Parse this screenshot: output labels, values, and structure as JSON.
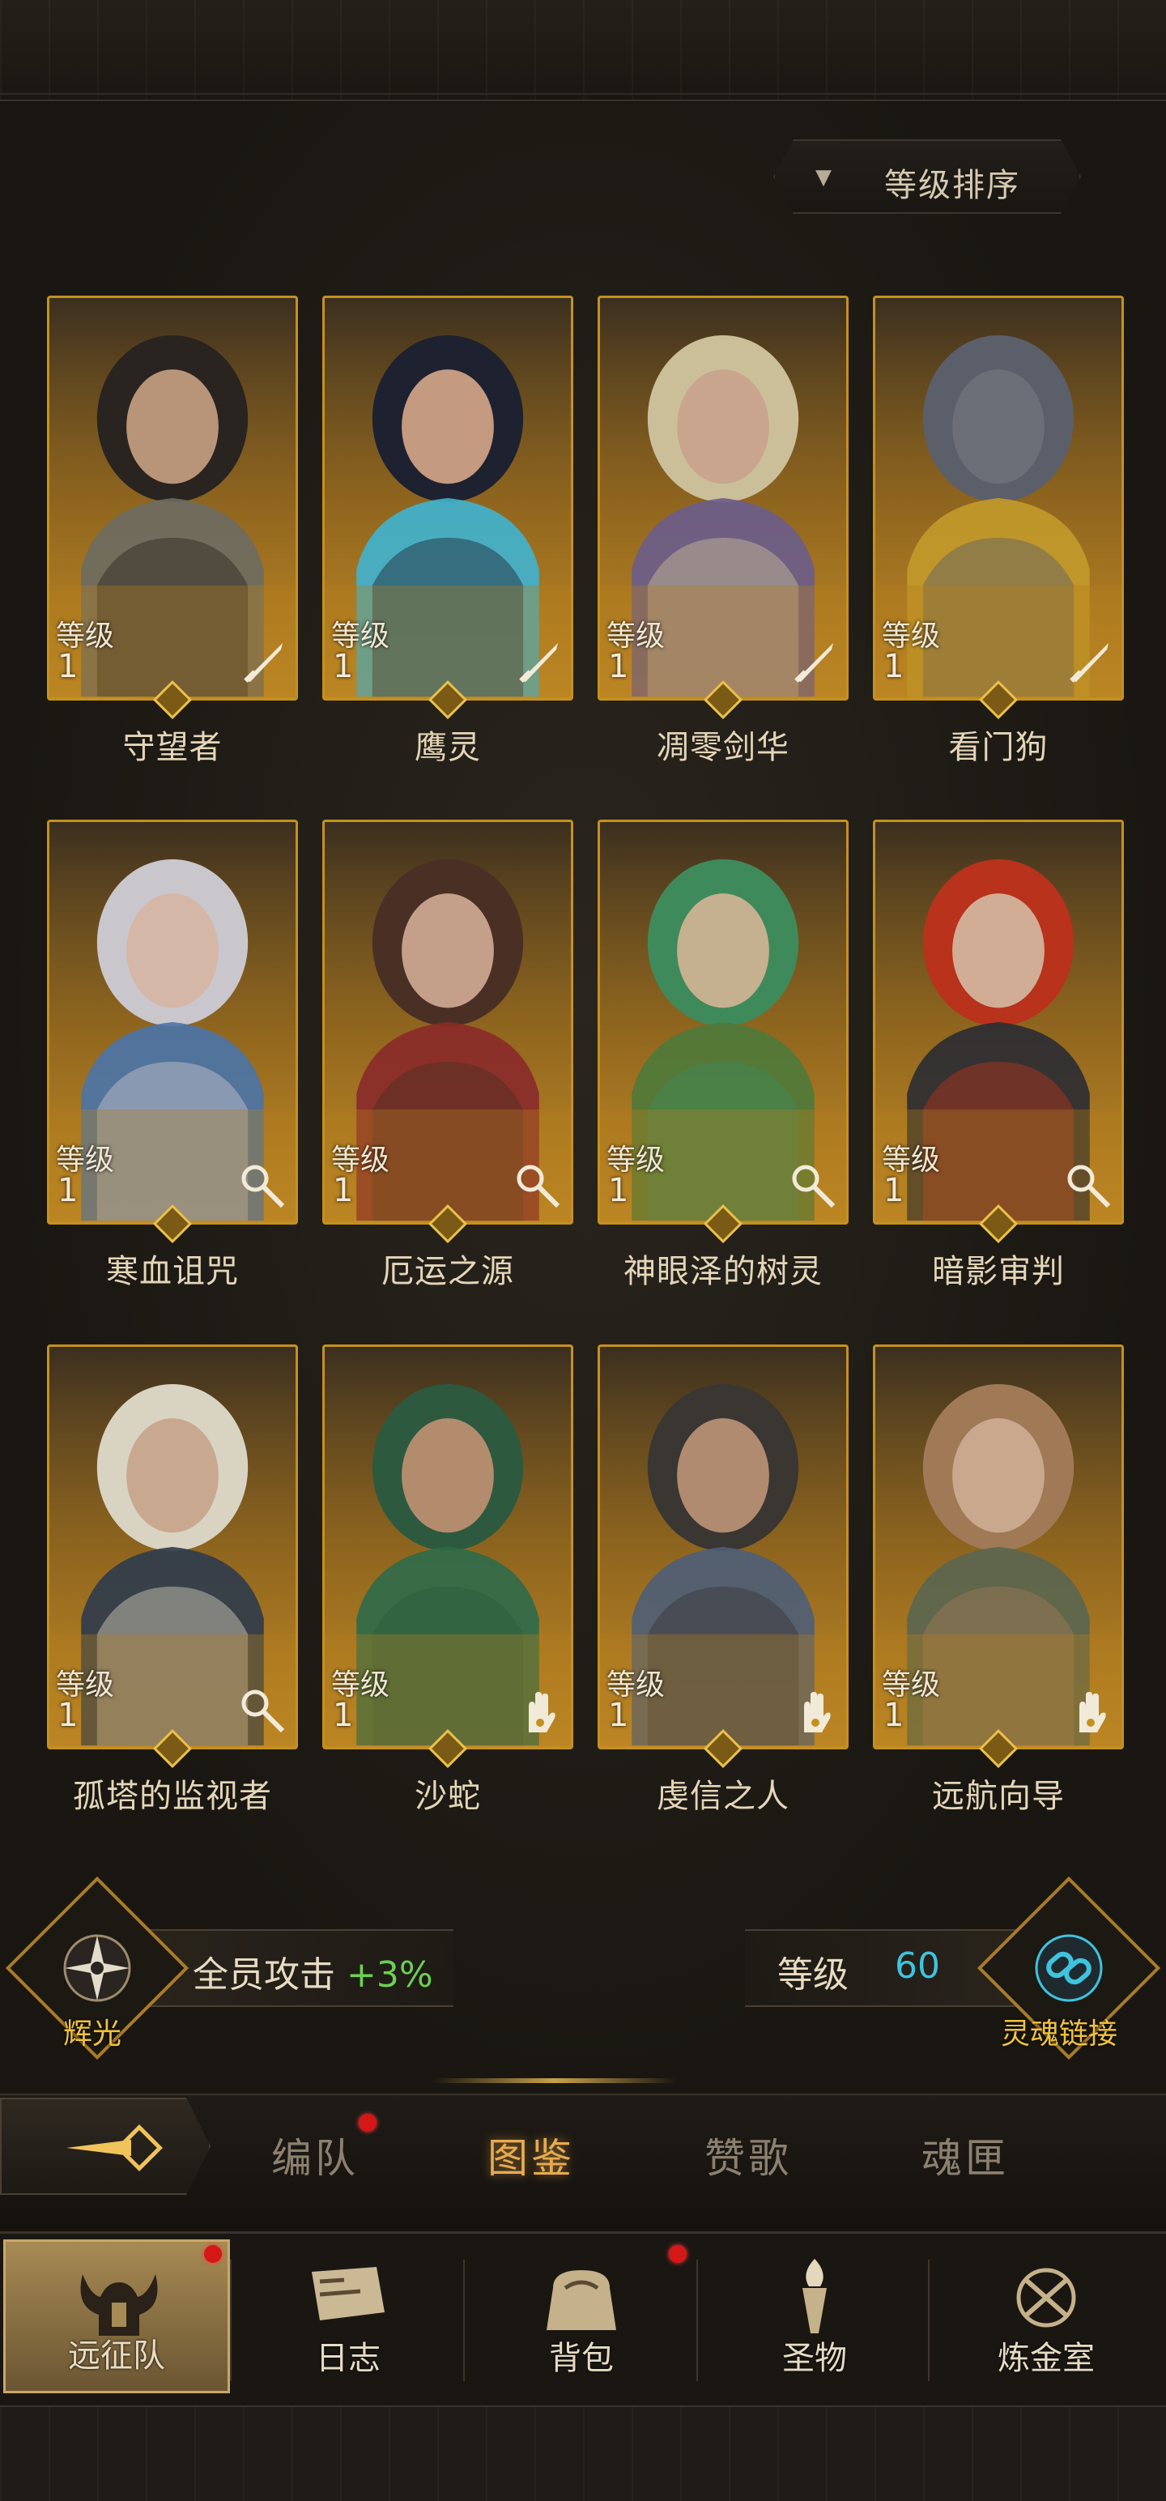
{
  "sort": {
    "label": "等级排序",
    "arrow": "▼"
  },
  "level_label": "等级",
  "heroes": [
    {
      "name": "守望者",
      "level": "1",
      "class_icon": "sword-icon",
      "hair": "#2a2420",
      "skin": "#b89578",
      "accent": "#6d6b62"
    },
    {
      "name": "鹰灵",
      "level": "1",
      "class_icon": "sword-icon",
      "hair": "#1e2230",
      "skin": "#c49a80",
      "accent": "#3fb4d0"
    },
    {
      "name": "凋零剑华",
      "level": "1",
      "class_icon": "sword-icon",
      "hair": "#cbbf9a",
      "skin": "#c9a58d",
      "accent": "#6a5d8c"
    },
    {
      "name": "看门狗",
      "level": "1",
      "class_icon": "sword-icon",
      "hair": "#5b5f6a",
      "skin": "#6c6f78",
      "accent": "#c29a2a"
    },
    {
      "name": "寒血诅咒",
      "level": "1",
      "class_icon": "staff-icon",
      "hair": "#c9c7cc",
      "skin": "#d4b7a6",
      "accent": "#4a74a8"
    },
    {
      "name": "厄运之源",
      "level": "1",
      "class_icon": "staff-icon",
      "hair": "#4a3024",
      "skin": "#c4a08a",
      "accent": "#8a2a2a"
    },
    {
      "name": "神眼泽的树灵",
      "level": "1",
      "class_icon": "staff-icon",
      "hair": "#3f8a5a",
      "skin": "#c5b090",
      "accent": "#4e7a3a"
    },
    {
      "name": "暗影审判",
      "level": "1",
      "class_icon": "staff-icon",
      "hair": "#b8321c",
      "skin": "#d2ad96",
      "accent": "#2a2c33"
    },
    {
      "name": "孤塔的监视者",
      "level": "1",
      "class_icon": "staff-icon",
      "hair": "#d9d3c2",
      "skin": "#c9a890",
      "accent": "#2d3b4d"
    },
    {
      "name": "沙蛇",
      "level": "1",
      "class_icon": "palm-icon",
      "hair": "#2d5a3e",
      "skin": "#b38c6e",
      "accent": "#2e6b4a"
    },
    {
      "name": "虔信之人",
      "level": "1",
      "class_icon": "palm-icon",
      "hair": "#3a3632",
      "skin": "#b08b70",
      "accent": "#4e5e78"
    },
    {
      "name": "远航向导",
      "level": "1",
      "class_icon": "palm-icon",
      "hair": "#a07a56",
      "skin": "#c9a88e",
      "accent": "#5a6650"
    }
  ],
  "bonus": {
    "emblem_label": "辉光",
    "text": "全员攻击",
    "value": "+3%",
    "level_text": "等级",
    "level_value": "60",
    "link_label": "灵魂链接"
  },
  "subtabs": [
    {
      "label": "编队",
      "badge": true,
      "active": false
    },
    {
      "label": "图鉴",
      "badge": false,
      "active": true
    },
    {
      "label": "赞歌",
      "badge": false,
      "active": false
    },
    {
      "label": "魂匣",
      "badge": false,
      "active": false
    }
  ],
  "bottom_nav": [
    {
      "label": "远征队",
      "icon": "horned-helmet-icon",
      "active": true,
      "badge": true
    },
    {
      "label": "日志",
      "icon": "scroll-icon",
      "active": false,
      "badge": false
    },
    {
      "label": "背包",
      "icon": "bag-icon",
      "active": false,
      "badge": true
    },
    {
      "label": "圣物",
      "icon": "torch-icon",
      "active": false,
      "badge": false
    },
    {
      "label": "炼金室",
      "icon": "alchemy-icon",
      "active": false,
      "badge": false
    }
  ],
  "colors": {
    "gold": "#c4911f",
    "active_tab": "#e8ab4f",
    "bonus_green": "#6ccf54",
    "level_cyan": "#3fc3de",
    "badge_red": "#d41818"
  }
}
